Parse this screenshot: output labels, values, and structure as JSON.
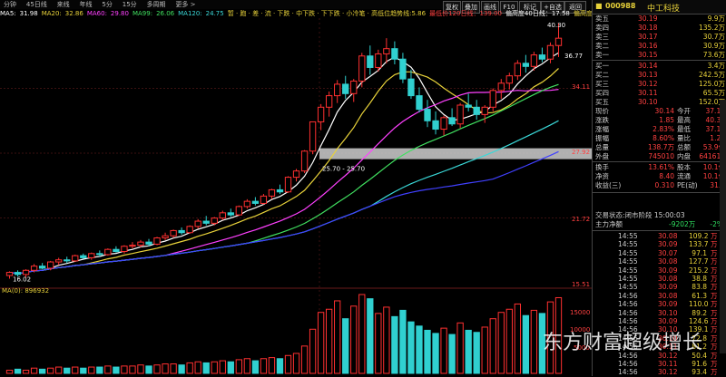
{
  "tabs": [
    "分钟",
    "45日线",
    "来线",
    "年线",
    "5分",
    "15分",
    "多周期",
    "更多 >"
  ],
  "ma_line": [
    {
      "label": "MA5:",
      "value": "31.98",
      "color": "#ffffff"
    },
    {
      "label": "MA20:",
      "value": "32.86",
      "color": "#e8d23a"
    },
    {
      "label": "MA60:",
      "value": "29.80",
      "color": "#ff40ff"
    },
    {
      "label": "MA99:",
      "value": "26.06",
      "color": "#40e060"
    },
    {
      "label": "MA120:",
      "value": "24.75",
      "color": "#3ad8d8"
    }
  ],
  "signal_line": [
    {
      "text": "暂 · 跑 · 差 · 流 · 下跌 · 中下跌 · 下下跌 · 小冷笔 · 高低位趋势线:5.86",
      "color": "#e8d23a"
    },
    {
      "text": "最低价120日线：139.00",
      "color": "#ff4040"
    },
    {
      "text": "偏高度40日线：17.58",
      "color": "#ffffff"
    },
    {
      "text": "偏高度250日线：48.04",
      "color": "#e8d23a"
    }
  ],
  "tool_buttons": [
    "复权",
    "叠加",
    "画线",
    "F10",
    "标记",
    "+自选",
    "返回"
  ],
  "stock": {
    "code": "000988",
    "name": "中工科技"
  },
  "price_labels": [
    {
      "text": "40.30",
      "color": "#ffffff"
    },
    {
      "text": "36.77",
      "color": "#ffffff"
    },
    {
      "text": "34.11",
      "color": "#ff4040"
    },
    {
      "text": "27.92",
      "color": "#ff4040"
    },
    {
      "text": "21.72",
      "color": "#ff4040"
    },
    {
      "text": "15.51",
      "color": "#ff4040"
    },
    {
      "text": "15000",
      "color": "#ff4040"
    },
    {
      "text": "10000",
      "color": "#ff4040"
    },
    {
      "text": "5000",
      "color": "#ff4040"
    }
  ],
  "annotations": {
    "range": "25.70 - 25.70",
    "low": "16.02",
    "ma_vol": "MA(0): 896932"
  },
  "order_book": {
    "asks": [
      {
        "label": "卖五",
        "price": "30.19",
        "vol": "9.9万"
      },
      {
        "label": "卖四",
        "price": "30.18",
        "vol": "135.2万"
      },
      {
        "label": "卖三",
        "price": "30.17",
        "vol": "30.7万"
      },
      {
        "label": "卖二",
        "price": "30.16",
        "vol": "30.9万"
      },
      {
        "label": "卖一",
        "price": "30.15",
        "vol": "73.6万"
      }
    ],
    "bids": [
      {
        "label": "买一",
        "price": "30.14",
        "vol": "3.4万"
      },
      {
        "label": "买二",
        "price": "30.13",
        "vol": "242.5万"
      },
      {
        "label": "买三",
        "price": "30.12",
        "vol": "125.0万"
      },
      {
        "label": "买四",
        "price": "30.11",
        "vol": "65.5万"
      },
      {
        "label": "买五",
        "price": "30.10",
        "vol": "152.0万"
      }
    ]
  },
  "stats": [
    {
      "l1": "现价",
      "v1": "30.14",
      "l2": "今开",
      "v2": "37.12"
    },
    {
      "l1": "涨跌",
      "v1": "1.85",
      "l2": "最高",
      "v2": "40.30"
    },
    {
      "l1": "涨幅",
      "v1": "2.83%",
      "l2": "最低",
      "v2": "37.11"
    },
    {
      "l1": "振幅",
      "v1": "8.60%",
      "l2": "量比",
      "v2": "1.27"
    },
    {
      "l1": "总量",
      "v1": "138.7万",
      "l2": "总额",
      "v2": "53.9亿"
    },
    {
      "l1": "外盘",
      "v1": "745010",
      "l2": "内盘",
      "v2": "641612"
    }
  ],
  "stats2": [
    {
      "l1": "换手",
      "v1": "13.61%",
      "l2": "股本",
      "v2": "10.1亿"
    },
    {
      "l1": "净资",
      "v1": "8.40",
      "l2": "流通",
      "v2": "10.1亿"
    },
    {
      "l1": "收益(三)",
      "v1": "0.310",
      "l2": "PE(动)",
      "v2": "31.1"
    }
  ],
  "trade_status": "交易状态:闭市阶段 15:00:03",
  "main_net": {
    "label": "主力净额",
    "value": "-9202万",
    "pct": "-2%"
  },
  "ticks": [
    {
      "t": "14:55",
      "p": "30.08",
      "v": "109.2",
      "f": "万"
    },
    {
      "t": "14:55",
      "p": "30.09",
      "v": "133.7",
      "f": "万"
    },
    {
      "t": "14:55",
      "p": "30.07",
      "v": "97.1",
      "f": "万"
    },
    {
      "t": "14:55",
      "p": "30.08",
      "v": "127.7",
      "f": "万"
    },
    {
      "t": "14:55",
      "p": "30.09",
      "v": "215.2",
      "f": "万"
    },
    {
      "t": "14:55",
      "p": "30.08",
      "v": "38.8",
      "f": "万"
    },
    {
      "t": "14:55",
      "p": "30.09",
      "v": "83.8",
      "f": "万"
    },
    {
      "t": "14:56",
      "p": "30.08",
      "v": "61.3",
      "f": "万"
    },
    {
      "t": "14:56",
      "p": "30.09",
      "v": "110.0",
      "f": "万"
    },
    {
      "t": "14:56",
      "p": "30.10",
      "v": "89.2",
      "f": "万"
    },
    {
      "t": "14:56",
      "p": "30.09",
      "v": "124.6",
      "f": "万"
    },
    {
      "t": "14:56",
      "p": "30.10",
      "v": "139.1",
      "f": "万"
    },
    {
      "t": "14:56",
      "p": "30.10",
      "v": "72.8",
      "f": "万"
    },
    {
      "t": "14:56",
      "p": "30.11",
      "v": "81.2",
      "f": "万"
    },
    {
      "t": "14:56",
      "p": "30.12",
      "v": "50.4",
      "f": "万"
    },
    {
      "t": "14:56",
      "p": "30.11",
      "v": "91.6",
      "f": "万"
    },
    {
      "t": "14:56",
      "p": "30.12",
      "v": "93.4",
      "f": "万"
    }
  ],
  "watermark": "东方财富超级增长",
  "colors": {
    "up": "#ff3030",
    "down": "#30d0d0",
    "bg": "#000000",
    "grid": "#3a1010",
    "yellow": "#e8d23a"
  },
  "chart_data": {
    "type": "candlestick",
    "y_range": [
      15.51,
      40.3
    ],
    "candles": [
      [
        16.2,
        16.6,
        15.9,
        16.5
      ],
      [
        16.5,
        16.7,
        16.1,
        16.3
      ],
      [
        16.3,
        16.8,
        16.0,
        16.7
      ],
      [
        16.7,
        17.3,
        16.5,
        17.1
      ],
      [
        17.1,
        17.4,
        16.8,
        16.9
      ],
      [
        16.9,
        17.6,
        16.7,
        17.5
      ],
      [
        17.5,
        17.9,
        17.2,
        17.7
      ],
      [
        17.7,
        18.0,
        17.4,
        17.6
      ],
      [
        17.6,
        18.2,
        17.5,
        18.1
      ],
      [
        18.1,
        18.3,
        17.8,
        17.9
      ],
      [
        17.9,
        18.4,
        17.7,
        18.3
      ],
      [
        18.3,
        18.6,
        18.0,
        18.2
      ],
      [
        18.2,
        18.8,
        18.1,
        18.7
      ],
      [
        18.7,
        19.0,
        18.4,
        18.5
      ],
      [
        18.5,
        19.1,
        18.3,
        19.0
      ],
      [
        19.0,
        19.4,
        18.8,
        19.1
      ],
      [
        19.1,
        19.6,
        18.9,
        19.4
      ],
      [
        19.4,
        19.7,
        19.0,
        19.2
      ],
      [
        19.2,
        19.9,
        19.1,
        19.8
      ],
      [
        19.8,
        20.3,
        19.6,
        20.0
      ],
      [
        20.0,
        20.6,
        19.8,
        20.5
      ],
      [
        20.5,
        20.8,
        20.1,
        20.3
      ],
      [
        20.3,
        21.0,
        20.2,
        20.9
      ],
      [
        20.9,
        21.6,
        20.7,
        21.4
      ],
      [
        21.4,
        21.9,
        21.0,
        21.2
      ],
      [
        21.2,
        21.8,
        21.0,
        21.7
      ],
      [
        21.7,
        22.4,
        21.5,
        22.2
      ],
      [
        22.2,
        22.6,
        21.8,
        22.0
      ],
      [
        22.0,
        22.9,
        21.9,
        22.8
      ],
      [
        22.8,
        23.5,
        22.6,
        23.3
      ],
      [
        23.3,
        23.7,
        22.9,
        23.1
      ],
      [
        23.1,
        24.0,
        23.0,
        23.8
      ],
      [
        23.8,
        24.5,
        23.5,
        24.4
      ],
      [
        24.4,
        24.9,
        24.0,
        24.2
      ],
      [
        24.2,
        25.7,
        24.1,
        25.6
      ],
      [
        25.6,
        26.4,
        25.2,
        26.2
      ],
      [
        26.2,
        28.2,
        26.0,
        28.1
      ],
      [
        28.1,
        30.9,
        27.8,
        30.9
      ],
      [
        30.9,
        32.6,
        30.1,
        32.3
      ],
      [
        32.3,
        33.8,
        31.4,
        33.4
      ],
      [
        33.4,
        34.9,
        32.7,
        34.5
      ],
      [
        34.5,
        35.3,
        33.1,
        33.6
      ],
      [
        33.6,
        35.0,
        32.8,
        34.8
      ],
      [
        34.8,
        37.5,
        34.2,
        37.2
      ],
      [
        37.2,
        38.2,
        35.4,
        36.1
      ],
      [
        36.1,
        37.8,
        35.7,
        37.4
      ],
      [
        37.4,
        38.9,
        36.5,
        37.9
      ],
      [
        37.9,
        38.6,
        36.4,
        36.9
      ],
      [
        36.9,
        37.5,
        34.6,
        35.0
      ],
      [
        35.0,
        35.9,
        33.1,
        33.4
      ],
      [
        33.4,
        34.2,
        31.8,
        32.1
      ],
      [
        32.1,
        33.0,
        30.4,
        31.0
      ],
      [
        31.0,
        31.9,
        29.7,
        30.2
      ],
      [
        30.2,
        31.5,
        29.6,
        31.3
      ],
      [
        31.3,
        32.2,
        30.5,
        30.7
      ],
      [
        30.7,
        32.7,
        30.3,
        32.5
      ],
      [
        32.5,
        33.6,
        31.9,
        32.3
      ],
      [
        32.3,
        33.0,
        31.1,
        31.6
      ],
      [
        31.6,
        32.5,
        30.8,
        32.3
      ],
      [
        32.3,
        34.1,
        31.9,
        33.9
      ],
      [
        33.9,
        35.0,
        33.1,
        34.6
      ],
      [
        34.6,
        35.6,
        34.0,
        35.3
      ],
      [
        35.3,
        36.8,
        34.9,
        36.5
      ],
      [
        36.5,
        37.3,
        35.6,
        36.2
      ],
      [
        36.2,
        37.6,
        35.8,
        37.3
      ],
      [
        37.3,
        38.0,
        36.6,
        36.9
      ],
      [
        36.9,
        38.5,
        36.5,
        38.2
      ],
      [
        38.2,
        40.3,
        37.1,
        38.9
      ]
    ],
    "volumes": [
      3,
      4,
      3,
      5,
      4,
      5,
      6,
      5,
      6,
      5,
      6,
      6,
      7,
      6,
      7,
      7,
      8,
      7,
      8,
      9,
      9,
      8,
      10,
      11,
      10,
      11,
      12,
      11,
      13,
      14,
      12,
      14,
      15,
      14,
      17,
      19,
      26,
      42,
      58,
      61,
      69,
      52,
      64,
      75,
      71,
      57,
      63,
      54,
      60,
      49,
      45,
      41,
      38,
      43,
      37,
      48,
      41,
      39,
      44,
      52,
      58,
      61,
      66,
      55,
      60,
      57,
      68,
      72
    ],
    "ma_colors": [
      "#ffffff",
      "#e8d23a",
      "#ff40ff",
      "#40e060",
      "#3ad8d8",
      "#4040ff"
    ]
  }
}
